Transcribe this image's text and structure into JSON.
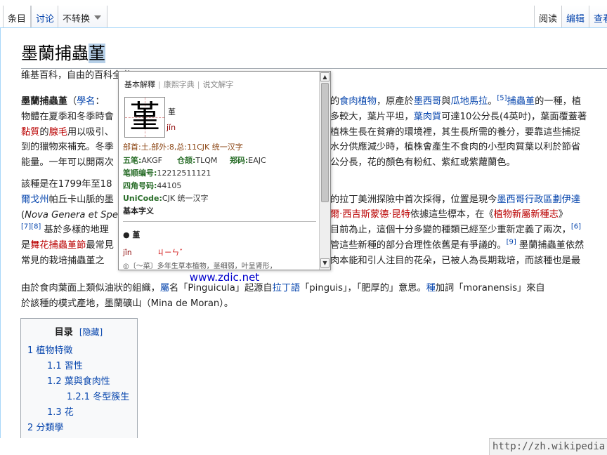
{
  "tabs": {
    "left": [
      {
        "label": "条目",
        "selected": true
      },
      {
        "label": "讨论",
        "selected": false
      },
      {
        "label": "不转换",
        "dropdown": true
      }
    ],
    "right": [
      {
        "label": "阅读",
        "selected": true
      },
      {
        "label": "编辑",
        "selected": false
      },
      {
        "label": "查看",
        "selected": false
      }
    ]
  },
  "article": {
    "title_main": "墨蘭捕蟲",
    "title_selected": "堇",
    "tagline": "维基百科，自由的百科全书",
    "paragraphs": [
      [
        [
          {
            "t": "墨蘭捕蟲堇",
            "b": true
          },
          {
            "t": "（"
          },
          {
            "t": "學名",
            "c": "link"
          },
          {
            "t": "："
          }
        ],
        [
          {
            "t": "物體在夏季和冬季時會"
          }
        ],
        [
          {
            "t": "黏質",
            "c": "red"
          },
          {
            "t": "的"
          },
          {
            "t": "腺毛",
            "c": "red"
          },
          {
            "t": "用以吸引、"
          }
        ],
        [
          {
            "t": "到的獵物來補充。冬季"
          }
        ],
        [
          {
            "t": "能量。一年可以開兩次"
          }
        ]
      ],
      [
        [
          {
            "t": "該種是在1799年至18"
          }
        ],
        [
          {
            "t": "爾戈州",
            "c": "link"
          },
          {
            "t": "帕丘卡山脈的墨"
          }
        ],
        [
          {
            "t": "("
          },
          {
            "t": "Nova Genera et Spec",
            "i": true
          }
        ],
        [
          {
            "t": "[7][8]",
            "c": "link",
            "sup": true
          },
          {
            "t": " 基於多樣的地理"
          }
        ],
        [
          {
            "t": "是"
          },
          {
            "t": "舞花捕蟲堇節",
            "c": "red"
          },
          {
            "t": "最常見"
          }
        ],
        [
          {
            "t": "常見的栽培捕蟲堇之"
          }
        ]
      ],
      [
        [
          {
            "t": "由於食肉葉面上類似油狀的組織，"
          },
          {
            "t": "屬",
            "c": "link"
          },
          {
            "t": "名「Pinguicula」起源自"
          },
          {
            "t": "拉丁語",
            "c": "link"
          },
          {
            "t": "「pinguis」，「肥厚的」意思。"
          },
          {
            "t": "種",
            "c": "link"
          },
          {
            "t": "加詞「moranensis」來自"
          }
        ],
        [
          {
            "t": "於該種的模式產地，墨蘭礦山（Mina de Moran）。"
          }
        ]
      ]
    ],
    "right_fragments": [
      [
        {
          "t": "的"
        },
        {
          "t": "食肉植物",
          "c": "link"
        },
        {
          "t": "，原產於"
        },
        {
          "t": "墨西哥",
          "c": "link"
        },
        {
          "t": "與"
        },
        {
          "t": "瓜地馬拉",
          "c": "link"
        },
        {
          "t": "。"
        },
        {
          "t": "[5]",
          "c": "link",
          "sup": true
        },
        {
          "t": "捕蟲堇",
          "c": "link"
        },
        {
          "t": "的一種，植"
        }
      ],
      [
        {
          "t": "多較大，葉片平坦，"
        },
        {
          "t": "葉肉質",
          "c": "link"
        },
        {
          "t": "可達10公分長(4英吋)，葉面覆蓋著"
        }
      ],
      [
        {
          "t": "植株生長在貧瘠的環境裡，其生長所需的養分，要靠這些捕捉"
        }
      ],
      [
        {
          "t": "水分供應減少時，植株會產生不食肉的小型肉質葉以利於節省"
        }
      ],
      [
        {
          "t": "公分長，花的顏色有粉紅、紫紅或紫蘿蘭色。"
        }
      ],
      [
        {
          "t": "的拉丁美洲探險中首次採得，位置是現今"
        },
        {
          "t": "墨西哥行政區劃伊達",
          "c": "link"
        }
      ],
      [
        {
          "t": "爾·西吉斯蒙德·昆特",
          "c": "red"
        },
        {
          "t": "依據這些標本，在《"
        },
        {
          "t": "植物新屬新種志",
          "c": "red"
        },
        {
          "t": "》"
        }
      ],
      [
        {
          "t": "目前為止，這個十分多變的種類已經至少重新定義了兩次，"
        },
        {
          "t": "[6]",
          "c": "link",
          "sup": true
        }
      ],
      [
        {
          "t": "管這些新種的部分合理性依舊是有爭議的。"
        },
        {
          "t": "[9]",
          "c": "link",
          "sup": true
        },
        {
          "t": " 墨蘭捕蟲堇依然"
        }
      ],
      [
        {
          "t": "肉本能和引人注目的花朵，已被人為長期栽培，而該種也是最"
        }
      ]
    ]
  },
  "toc": {
    "title": "目录",
    "toggle": "[隐藏]",
    "items": [
      {
        "num": "1",
        "text": "植物特徵",
        "level": 1
      },
      {
        "num": "1.1",
        "text": "習性",
        "level": 2
      },
      {
        "num": "1.2",
        "text": "葉與食肉性",
        "level": 2
      },
      {
        "num": "1.2.1",
        "text": "冬型簇生",
        "level": 3
      },
      {
        "num": "1.3",
        "text": "花",
        "level": 2
      },
      {
        "num": "2",
        "text": "分類學",
        "level": 1
      }
    ]
  },
  "popup": {
    "tabs": [
      "基本解釋",
      "康熙字典",
      "说文解字"
    ],
    "char": "堇",
    "pinyin": "jǐn",
    "bushou": "部首:土,部外:8,总:11CJK 统一汉字",
    "wubi_label": "五笔:",
    "wubi": "AKGF",
    "cangjie_label": "仓颉:",
    "cangjie": "TLQM",
    "zhengma_label": "郑码:",
    "zhengma": "EAJC",
    "bishun_label": "笔顺编号:",
    "bishun": "12212511121",
    "sijiao_label": "四角号码:",
    "sijiao": "44105",
    "unicode_label": "UniCode:",
    "unicode": "CJK 统一汉字",
    "basic_label": "基本字义",
    "word_head": "● 堇",
    "def_pinyin": "jǐn",
    "def_zhuyin": "ㄐㄧㄣˇ",
    "def_text": "◎〔～菜〕多年生草本植物，茎细弱，叶呈肾形，",
    "source": "www.zdic.net"
  },
  "statusbar": {
    "url": "http://zh.wikipedia.org"
  }
}
